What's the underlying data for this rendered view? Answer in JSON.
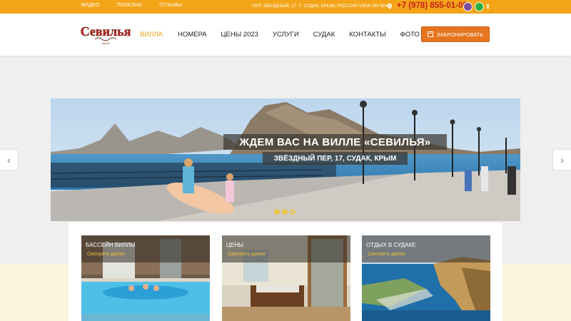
{
  "topbar": {
    "links": [
      "ВИДЕО",
      "ПОЛЕЗНО",
      "ОТЗЫВЫ"
    ],
    "address": "ПЕР. ЗВЕЗДНЫЙ, 17, Г. СУДАК, КРЫМ, РОССИЯ VIEW ON MAP",
    "phone": "+7 (978) 855-01-00"
  },
  "header": {
    "logo_text": "Севилья",
    "logo_sub": "вилла",
    "nav": [
      "ВИЛЛА",
      "НОМЕРА",
      "ЦЕНЫ 2023",
      "УСЛУГИ",
      "СУДАК",
      "КОНТАКТЫ",
      "ФОТО"
    ],
    "book_button": "ЗАБРОНИРОВАТЬ"
  },
  "banner": {
    "title": "ЖДЕМ ВАС НА ВИЛЛЕ «СЕВИЛЬЯ»",
    "subtitle": "ЗВЁЗДНЫЙ ПЕР, 17, СУДАК, КРЫМ",
    "slides": 3,
    "active_slide": 3
  },
  "tiles": [
    {
      "title": "БАССЕЙН ВИЛЛЫ",
      "more": "Смотреть далее"
    },
    {
      "title": "ЦЕНЫ",
      "more": "Смотреть далее"
    },
    {
      "title": "ОТДЫХ В СУДАКЕ",
      "more": "Смотреть далее"
    }
  ],
  "colors": {
    "accent": "#f3a417",
    "button": "#e6751f",
    "phone": "#c8201f"
  }
}
